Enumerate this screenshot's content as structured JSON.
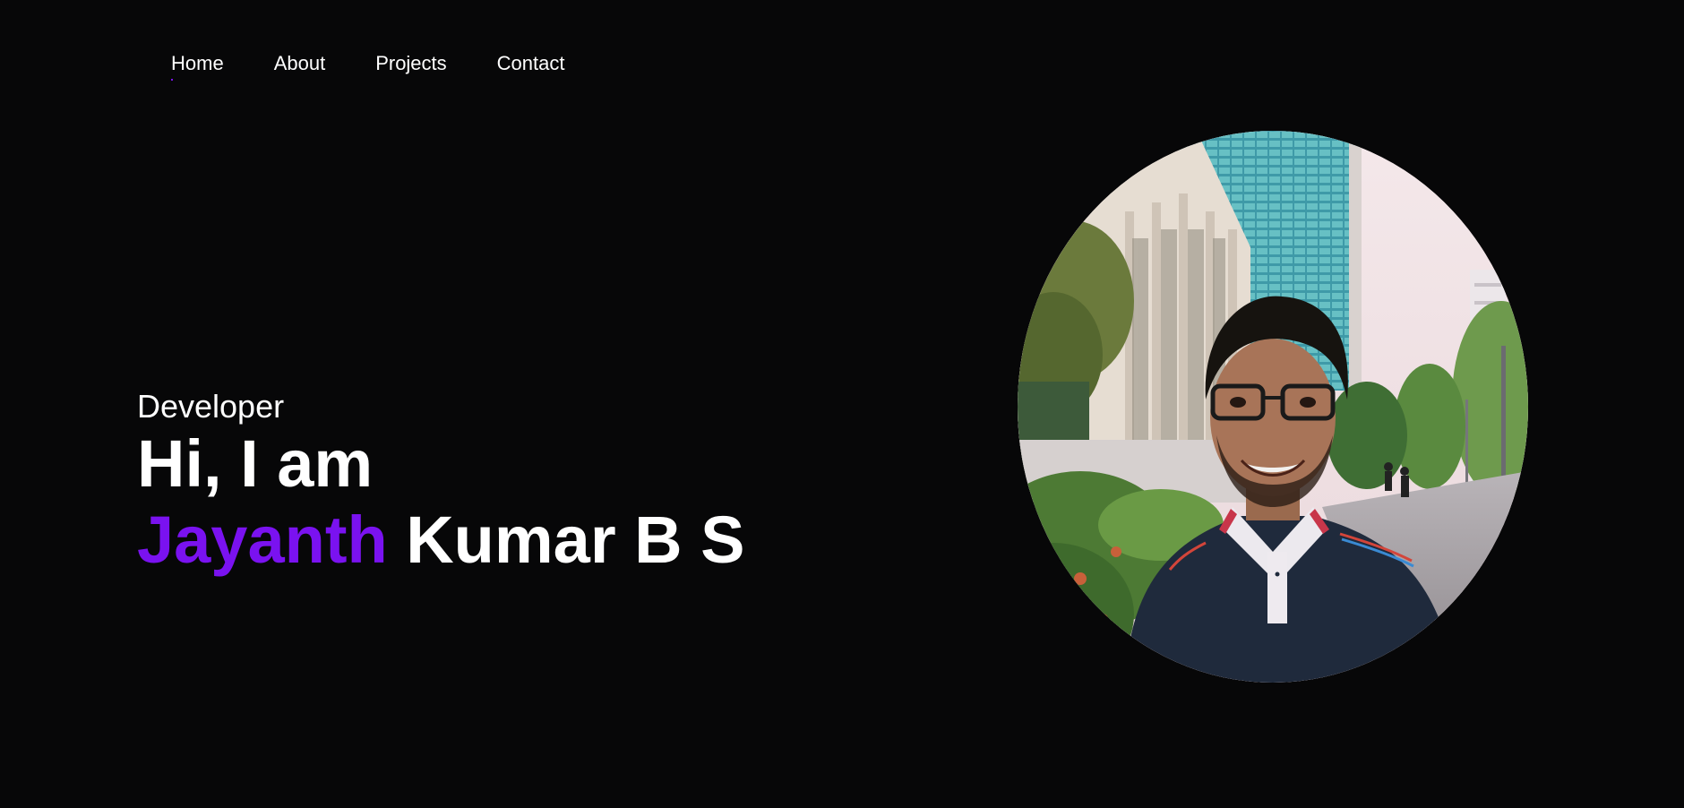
{
  "nav": {
    "items": [
      {
        "label": "Home",
        "active": true
      },
      {
        "label": "About",
        "active": false
      },
      {
        "label": "Projects",
        "active": false
      },
      {
        "label": "Contact",
        "active": false
      }
    ],
    "active_underline_color": "#7a12f0"
  },
  "hero": {
    "role": "Developer",
    "greeting": "Hi, I am",
    "first_name": "Jayanth",
    "last_name": " Kumar B S",
    "accent_color": "#7a12f0"
  },
  "portrait": {
    "description": "profile-photo"
  }
}
